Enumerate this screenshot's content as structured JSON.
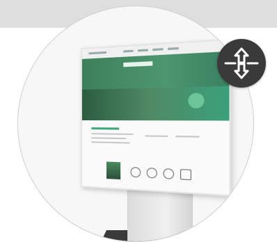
{
  "image": {
    "subject": "monitor-on-stand",
    "icons": [
      "arrows-vertical-icon"
    ],
    "colors": {
      "top_band": "#dedede",
      "accent_green": "#3fa877",
      "badge_bg": "#3a3a3a"
    }
  }
}
